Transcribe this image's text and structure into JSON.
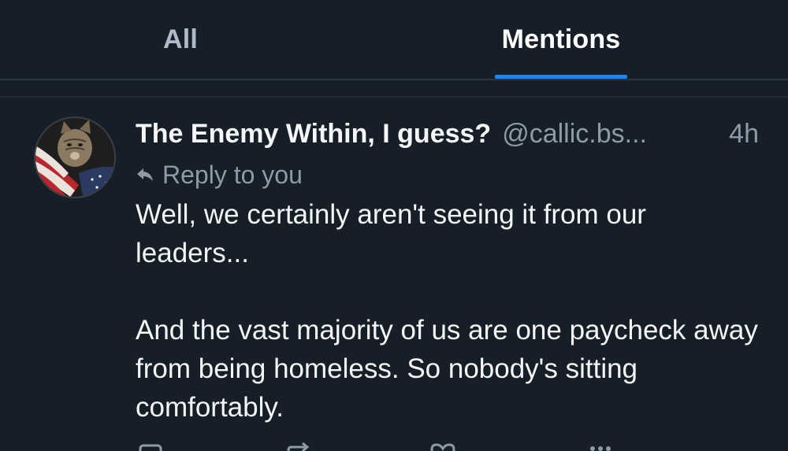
{
  "tabs": [
    {
      "label": "All",
      "active": false
    },
    {
      "label": "Mentions",
      "active": true
    }
  ],
  "post": {
    "author_name": "The Enemy Within, I guess?",
    "author_handle": "@callic.bs...",
    "time": "4h",
    "reply_label": "Reply to you",
    "paragraphs": [
      "Well, we certainly aren't seeing it from our leaders...",
      "And the vast majority of us are one paycheck away from being homeless. So nobody's sitting comfortably."
    ],
    "icons": {
      "avatar": "cat-with-flag-avatar",
      "reply": "reply-arrow-icon",
      "actions": [
        "comment-icon",
        "repost-icon",
        "like-icon",
        "more-icon"
      ]
    }
  },
  "colors": {
    "background": "#161e27",
    "accent": "#1a85ff",
    "muted_text": "#8e9aa8",
    "primary_text": "#f4f6f8",
    "divider": "#2b3644"
  }
}
